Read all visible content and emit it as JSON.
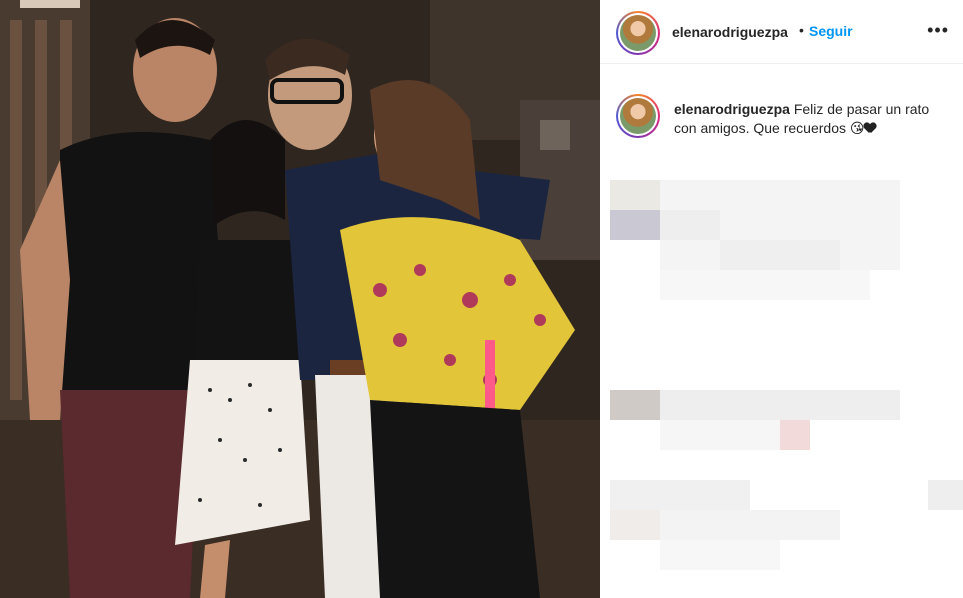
{
  "post": {
    "username": "elenarodriguezpa",
    "separator": "•",
    "follow_label": "Seguir",
    "more_icon": "more-options-icon",
    "caption": {
      "username": "elenarodriguezpa",
      "text": "Feliz de pasar un rato con amigos. Que recuerdos",
      "emojis": [
        "winking-kiss-emoji",
        "black-heart-emoji"
      ]
    }
  },
  "photo": {
    "description_icon": "group-photo-image"
  },
  "colors": {
    "link_blue": "#0095f6",
    "text": "#262626",
    "divider": "#efefef"
  }
}
